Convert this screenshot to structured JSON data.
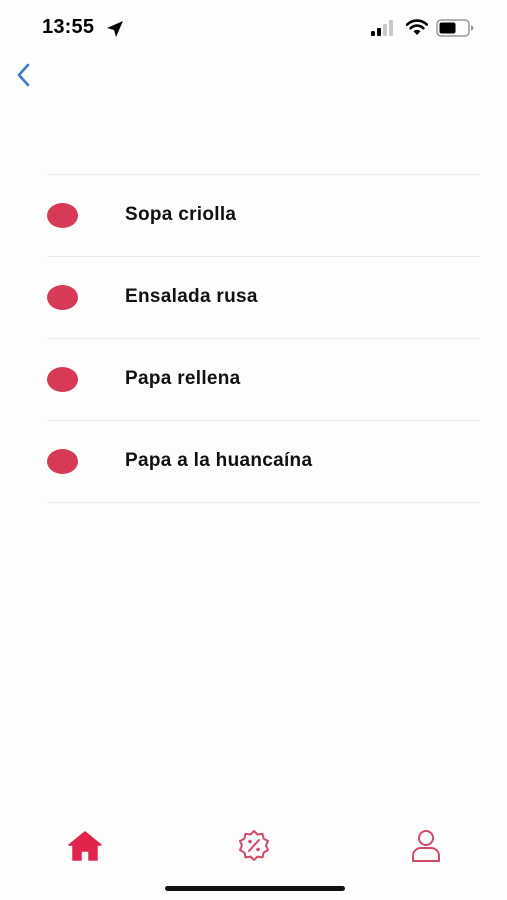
{
  "status_bar": {
    "time": "13:55",
    "icons": [
      "location-arrow-icon",
      "cellular-signal-icon",
      "wifi-icon",
      "battery-icon"
    ]
  },
  "nav": {
    "back_icon": "chevron-left-icon",
    "accent_color": "#3a7bd5"
  },
  "dishes": [
    {
      "label": "Sopa criolla"
    },
    {
      "label": "Ensalada rusa"
    },
    {
      "label": "Papa rellena"
    },
    {
      "label": "Papa a la huancaína"
    }
  ],
  "dot_color": "#d63a57",
  "tab_bar": {
    "active_color": "#e0244c",
    "inactive_color": "#d04a66",
    "tabs": [
      {
        "icon": "home-icon",
        "active": true
      },
      {
        "icon": "discount-badge-icon",
        "active": false
      },
      {
        "icon": "user-icon",
        "active": false
      }
    ]
  }
}
